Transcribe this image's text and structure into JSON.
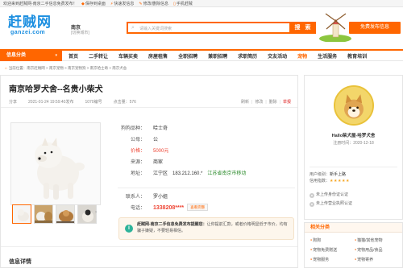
{
  "topbar": {
    "welcome": "欢迎来到赶贼网-南京二手信息免费发布！",
    "links": [
      {
        "icon": "shield-icon",
        "label": "保存到桌面"
      },
      {
        "icon": "lightning-icon",
        "label": "快速发信息"
      },
      {
        "icon": "edit-icon",
        "label": "修改/删除信息"
      },
      {
        "icon": "phone-icon",
        "label": "手机赶贼"
      }
    ]
  },
  "header": {
    "logo_cn": "赶贼网",
    "logo_en": "ganzei.com",
    "city": "南京",
    "city_switch": "[切换城市]",
    "search_placeholder": "请输入关键词搜索",
    "search_button": "搜 索",
    "post_button": "免费发布信息"
  },
  "nav": {
    "category_label": "信息分类",
    "items": [
      {
        "label": "首页",
        "active": false
      },
      {
        "label": "二手转让",
        "active": false
      },
      {
        "label": "车辆买卖",
        "active": false
      },
      {
        "label": "房屋租售",
        "active": false
      },
      {
        "label": "全职招聘",
        "active": false
      },
      {
        "label": "兼职招聘",
        "active": false
      },
      {
        "label": "求职简历",
        "active": false
      },
      {
        "label": "交友活动",
        "active": false
      },
      {
        "label": "宠物",
        "active": true
      },
      {
        "label": "生活服务",
        "active": false
      },
      {
        "label": "教育培训",
        "active": false
      }
    ]
  },
  "breadcrumb": {
    "home": "当前位置：",
    "path": "南京赶贼网 > 南京宠物 > 南京宠物狗 > 南京哈士奇 > 南京犬舍"
  },
  "listing": {
    "title": "南京哈罗犬舍--名贵小柴犬",
    "share": "分享",
    "posted": "2021-01-24 19:59:40发布",
    "id": "1070编号",
    "views": "点击量：576",
    "actions": {
      "refresh": "刷新",
      "edit": "修改",
      "delete": "删除",
      "report": "举报"
    },
    "fields": {
      "breed_key": "狗狗品种：",
      "breed_val": "哈士奇",
      "gender_key": "公母：",
      "gender_val": "公",
      "price_key": "价格：",
      "price_val": "5000元",
      "source_key": "来源：",
      "source_val": "商家",
      "location_key": "地址：",
      "location_val": "江宁区",
      "ip": "183.212.160.*",
      "ip_location": "江苏省南京市移动"
    },
    "contact_key": "联系人：",
    "contact_val": "罗小姐",
    "phone_key": "电话：",
    "phone_val": "1338208****",
    "phone_button": "查看完整",
    "notice_title": "赶贼网-南京二手信息免费发布提醒您：",
    "notice_text": "让你提前汇款，或者价格明显低于市价，均有骗子嫌疑，不要轻易相信。",
    "detail_title": "信息详情",
    "thumb_more": "›"
  },
  "seller": {
    "shop_name": "Hallo柴犬屋-哈罗犬舍",
    "since": "注册时间：2020-12-18",
    "level_label": "用户级别：",
    "level_value": "新手上路",
    "credit_label": "信用指数：",
    "credit_stars": "★★★★★",
    "verify": [
      "未上传身份证认证",
      "未上传营业执照认证"
    ]
  },
  "related": {
    "title": "相关分类",
    "items": [
      "狗狗",
      "猫猫/其他宠物",
      "宠物免费赠送",
      "宠物用品/食品",
      "宠物服务",
      "宠物寄养"
    ]
  },
  "colors": {
    "accent": "#ff6600",
    "logo_blue": "#1a8ee0",
    "price_red": "#ee4433",
    "notice_green": "#2eb39a"
  }
}
